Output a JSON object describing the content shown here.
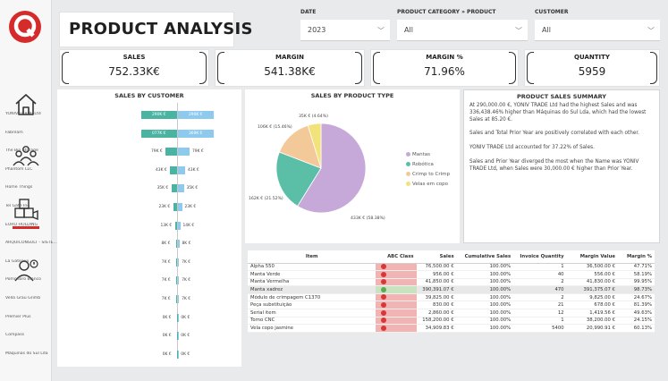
{
  "header": {
    "title": "PRODUCT ANALYSIS"
  },
  "filters": {
    "date": {
      "label": "DATE",
      "value": "2023"
    },
    "category": {
      "label": "PRODUCT CATEGORY » PRODUCT",
      "value": "All"
    },
    "customer": {
      "label": "CUSTOMER",
      "value": "All"
    }
  },
  "kpis": [
    {
      "label": "SALES",
      "value": "752.33K€"
    },
    {
      "label": "MARGIN",
      "value": "541.38K€"
    },
    {
      "label": "MARGIN %",
      "value": "71.96%"
    },
    {
      "label": "QUANTITY",
      "value": "5959"
    }
  ],
  "sidebar": {
    "icons": [
      "home-icon",
      "people-icon",
      "products-icon",
      "support-icon"
    ],
    "accent": "#d62b2b"
  },
  "sales_by_customer": {
    "title": "SALES BY CUSTOMER",
    "rows": [
      {
        "name": "YONIV TRADE Ltd",
        "left": "290K €",
        "right": "290K €"
      },
      {
        "name": "Fabrilam",
        "left": "077K €",
        "right": "369K €"
      },
      {
        "name": "The Bin Storage",
        "left": "79K €",
        "right": "79K €"
      },
      {
        "name": "Phantom LLC",
        "left": "43K €",
        "right": "43K €"
      },
      {
        "name": "Home Things",
        "left": "35K €",
        "right": "35K €"
      },
      {
        "name": "Tel Gate Inc.",
        "left": "23K €",
        "right": "23K €"
      },
      {
        "name": "EURO HOLDING",
        "left": "13K €",
        "right": "14K €"
      },
      {
        "name": "ARQUICONSULT - SISTE...",
        "left": "8K €",
        "right": "8K €"
      },
      {
        "name": "La Gateaux",
        "left": "7K €",
        "right": "7K €"
      },
      {
        "name": "Pomodoro Bianco",
        "left": "7K €",
        "right": "7K €"
      },
      {
        "name": "Vella Grau Grimb",
        "left": "7K €",
        "right": "7K €"
      },
      {
        "name": "Premier Plus",
        "left": "0K €",
        "right": "0K €"
      },
      {
        "name": "Compass",
        "left": "0K €",
        "right": "0K €"
      },
      {
        "name": "Máquinas do Sul Lda",
        "left": "0K €",
        "right": "0K €"
      }
    ]
  },
  "sales_by_product_type": {
    "title": "SALES BY PRODUCT TYPE",
    "slices": [
      {
        "name": "Mantas",
        "value": 433,
        "label": "433K € (58.38%)",
        "color": "#c7a9d9"
      },
      {
        "name": "Robótica",
        "value": 162,
        "label": "162K € (21.52%)",
        "color": "#5bbfa8"
      },
      {
        "name": "Crimp to Crimp",
        "value": 106,
        "label": "106K € (15.46%)",
        "color": "#f4c99a"
      },
      {
        "name": "Velas em copo",
        "value": 35,
        "label": "35K € (4.64%)",
        "color": "#f2e27a"
      }
    ]
  },
  "summary": {
    "title": "PRODUCT SALES SUMMARY",
    "paragraphs": [
      "At 290,000.00 €, YONIV TRADE Ltd had the highest Sales and was 336,438.46% higher than Máquinas do Sul Lda, which had the lowest Sales at 85.20 €.",
      "Sales and Total Prior Year are positively correlated with each other.",
      "YONIV TRADE Ltd accounted for 37.22% of Sales.",
      "Sales and Prior Year diverged the most when the Name was YONIV TRADE Ltd, when Sales were 30,000.00 € higher than Prior Year."
    ]
  },
  "table": {
    "columns": [
      "Item",
      "ABC Class",
      "Sales",
      "Cumulative Sales",
      "Invoice Quantity",
      "Margin Value",
      "Margin %"
    ],
    "rows": [
      {
        "item": "Alpha 550",
        "abc": "red",
        "sales": "76,500.00 €",
        "cum": "100.00%",
        "qty": "1",
        "margin": "36,500.00 €",
        "pct": "47.71%"
      },
      {
        "item": "Manta Verde",
        "abc": "red",
        "sales": "956.00 €",
        "cum": "100.00%",
        "qty": "40",
        "margin": "556.00 €",
        "pct": "58.19%"
      },
      {
        "item": "Manta Vermelha",
        "abc": "red",
        "sales": "41,850.00 €",
        "cum": "100.00%",
        "qty": "2",
        "margin": "41,830.00 €",
        "pct": "99.95%"
      },
      {
        "item": "Manta xadrez",
        "abc": "green",
        "sales": "390,391.07 €",
        "cum": "100.00%",
        "qty": "470",
        "margin": "391,375.07 €",
        "pct": "98.73%"
      },
      {
        "item": "Módulo de crimpagem C1370",
        "abc": "red",
        "sales": "39,825.00 €",
        "cum": "100.00%",
        "qty": "2",
        "margin": "9,825.00 €",
        "pct": "24.67%"
      },
      {
        "item": "Peça substituição",
        "abc": "red",
        "sales": "830.00 €",
        "cum": "100.00%",
        "qty": "21",
        "margin": "678.00 €",
        "pct": "81.39%"
      },
      {
        "item": "Serial item",
        "abc": "red",
        "sales": "2,860.00 €",
        "cum": "100.00%",
        "qty": "12",
        "margin": "1,419.56 €",
        "pct": "49.63%"
      },
      {
        "item": "Torno CNC",
        "abc": "red",
        "sales": "158,200.00 €",
        "cum": "100.00%",
        "qty": "1",
        "margin": "38,200.00 €",
        "pct": "24.15%"
      },
      {
        "item": "Vela copo jasmine",
        "abc": "red",
        "sales": "34,909.83 €",
        "cum": "100.00%",
        "qty": "5400",
        "margin": "20,990.91 €",
        "pct": "60.13%"
      }
    ]
  }
}
